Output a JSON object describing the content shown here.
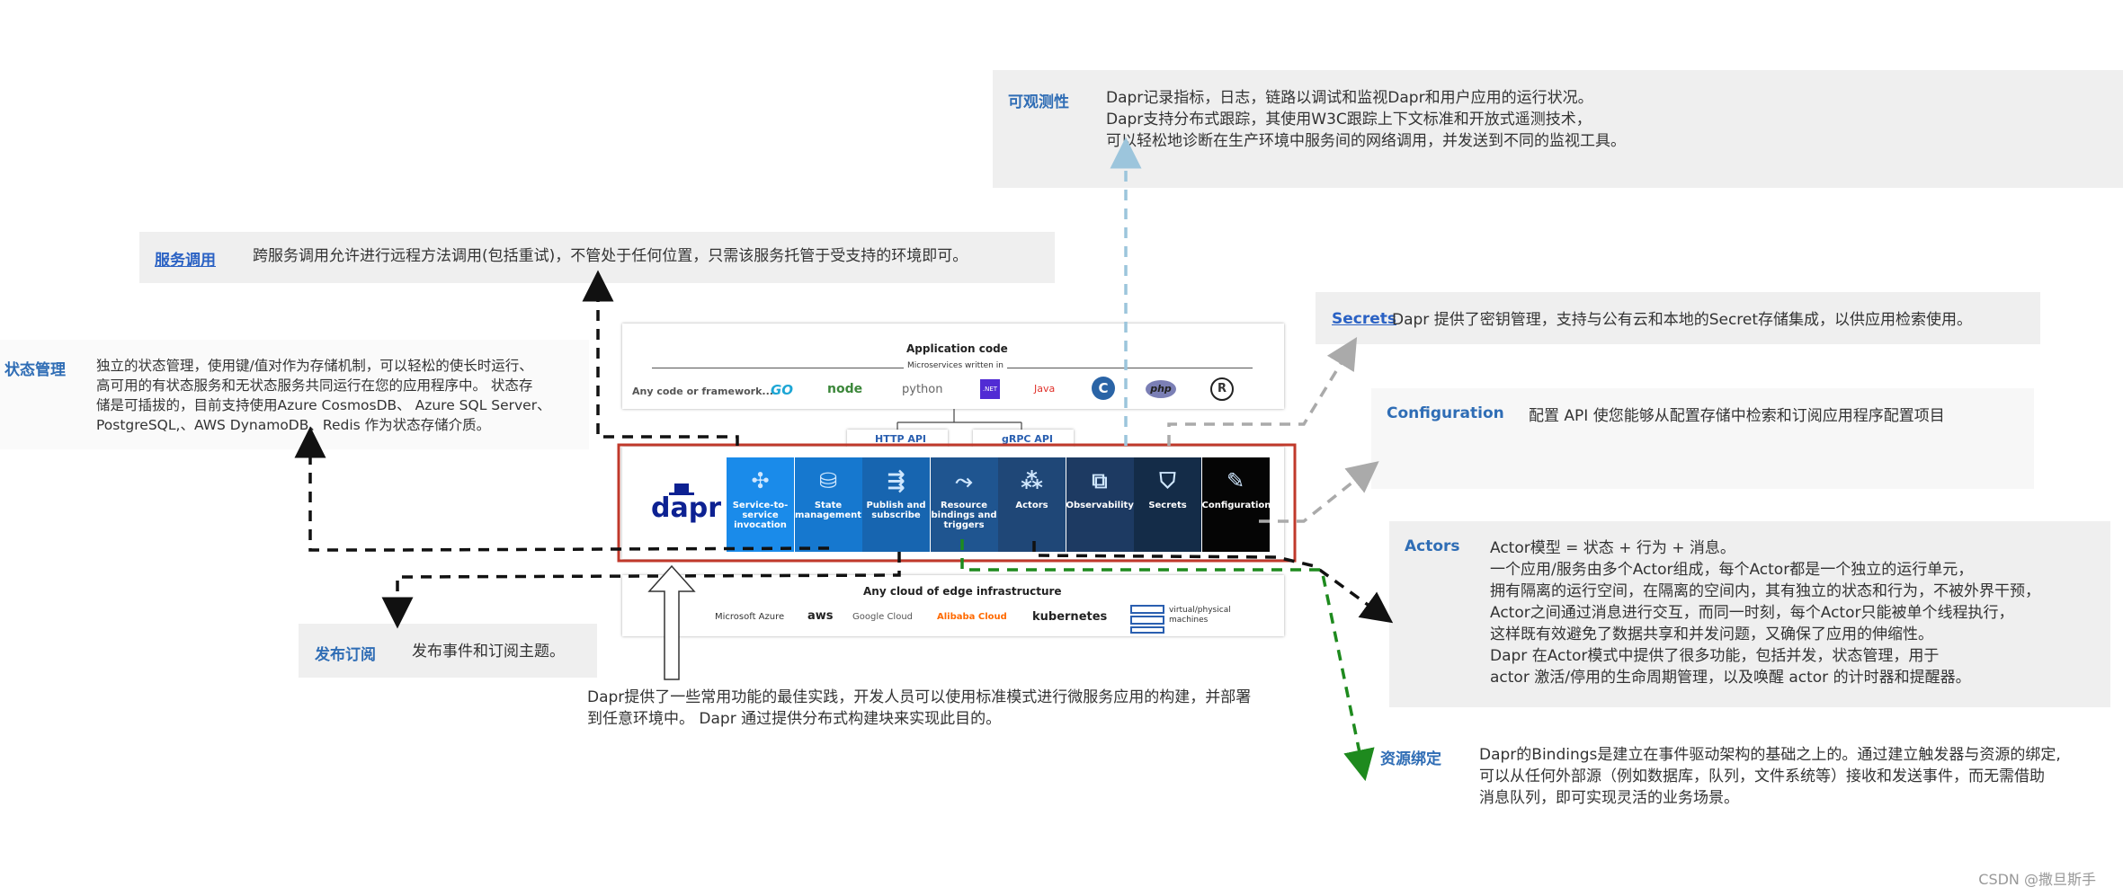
{
  "observability": {
    "label": "可观测性",
    "lines": "Dapr记录指标，日志，链路以调试和监视Dapr和用户应用的运行状况。\nDapr支持分布式跟踪，其使用W3C跟踪上下文标准和开放式遥测技术，\n可以轻松地诊断在生产环境中服务间的网络调用，并发送到不同的监视工具。"
  },
  "service_invocation": {
    "label": "服务调用",
    "text": "跨服务调用允许进行远程方法调用(包括重试)，不管处于任何位置，只需该服务托管于受支持的环境即可。"
  },
  "state_management": {
    "label": "状态管理",
    "text": "独立的状态管理，使用键/值对作为存储机制，可以轻松的使长时运行、\n高可用的有状态服务和无状态服务共同运行在您的应用程序中。 状态存\n储是可插拔的，目前支持使用Azure CosmosDB、 Azure SQL Server、\nPostgreSQL,、AWS DynamoDB、Redis 作为状态存储介质。"
  },
  "secrets": {
    "label": "Secrets",
    "text": " Dapr 提供了密钥管理，支持与公有云和本地的Secret存储集成，以供应用检索使用。"
  },
  "configuration": {
    "label": "Configuration",
    "text": "配置 API 使您能够从配置存储中检索和订阅应用程序配置项目"
  },
  "actors": {
    "label": "Actors",
    "text": "Actor模型 = 状态 + 行为 + 消息。\n        一个应用/服务由多个Actor组成，每个Actor都是一个独立的运行单元，\n拥有隔离的运行空间，在隔离的空间内，其有独立的状态和行为，不被外界干预，\nActor之间通过消息进行交互，而同一时刻，每个Actor只能被单个线程执行，\n这样既有效避免了数据共享和并发问题，又确保了应用的伸缩性。\n        Dapr 在Actor模式中提供了很多功能，包括并发，状态管理，用于\nactor 激活/停用的生命周期管理，以及唤醒 actor 的计时器和提醒器。"
  },
  "pubsub": {
    "label": "发布订阅",
    "text": "发布事件和订阅主题。"
  },
  "bindings": {
    "label": "资源绑定",
    "text": "Dapr的Bindings是建立在事件驱动架构的基础之上的。通过建立触发器与资源的绑定,\n可以从任何外部源（例如数据库，队列，文件系统等）接收和发送事件，而无需借助\n消息队列，即可实现灵活的业务场景。"
  },
  "center_caption": "Dapr提供了一些常用功能的最佳实践，开发人员可以使用标准模式进行微服务应用的构建，并部署\n到任意环境中。 Dapr 通过提供分布式构建块来实现此目的。",
  "diagram": {
    "app_code_title": "Application code",
    "microservices_label": "Microservices written in",
    "any_code_label": "Any code or framework...",
    "languages": [
      "GO",
      "node",
      "python",
      ".NET",
      "Java",
      "C",
      "php",
      "R"
    ],
    "http_api": "HTTP API",
    "grpc_api": "gRPC API",
    "dapr_logo": "dapr",
    "building_blocks": [
      {
        "name": "Service-to-service invocation",
        "color": "#1a8bea"
      },
      {
        "name": "State management",
        "color": "#1678cf"
      },
      {
        "name": "Publish and subscribe",
        "color": "#1765b0"
      },
      {
        "name": "Resource bindings and triggers",
        "color": "#1f5590"
      },
      {
        "name": "Actors",
        "color": "#1f4777"
      },
      {
        "name": "Observability",
        "color": "#1d3a62"
      },
      {
        "name": "Secrets",
        "color": "#142c48"
      },
      {
        "name": "Configuration",
        "color": "#050505"
      }
    ],
    "infra_title": "Any cloud of edge infrastructure",
    "clouds": [
      "Microsoft Azure",
      "aws",
      "Google Cloud",
      "Alibaba Cloud",
      "kubernetes",
      "virtual/physical machines"
    ]
  },
  "watermark": "CSDN @撒旦斯手"
}
